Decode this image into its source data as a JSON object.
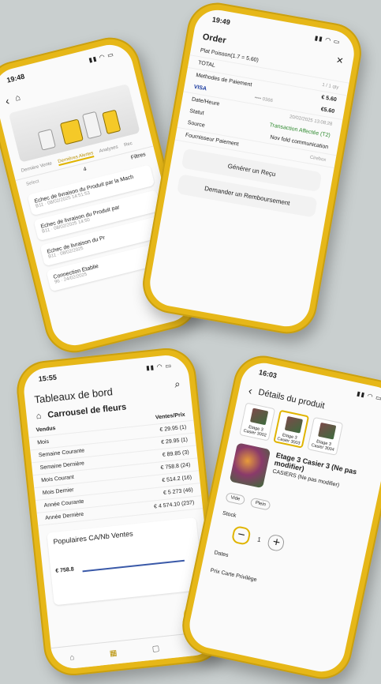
{
  "phone1": {
    "time": "19:48",
    "tabs": [
      "Dernière Vente",
      "Dernières Alertes",
      "Analyses",
      "Rec"
    ],
    "filters": {
      "select": "Select",
      "count": "4",
      "label": "Filtres"
    },
    "alerts": [
      {
        "title": "Echec de livraison du Produit par la Mach",
        "id": "B11",
        "date": "08/02/2025 14:51:53"
      },
      {
        "title": "Echec de livraison du Produit par",
        "id": "B11",
        "date": "08/02/2025 14:50"
      },
      {
        "title": "Echec de livraison du Pr",
        "id": "B11",
        "date": "08/02/2025"
      },
      {
        "title": "Connection Etablie",
        "id": "96",
        "date": "24/02/2025"
      }
    ]
  },
  "phone2": {
    "time": "19:49",
    "title": "Order",
    "product_line": "Plat Poisson(1.7 = 5.60)",
    "total_label": "TOTAL",
    "total_value": "1 / 1 qty",
    "payment_methods_label": "Methodes de Paiement",
    "payment_amount": "€ 5.60",
    "card_brand": "VISA",
    "card_last4": "•••• 0366",
    "details": [
      {
        "k": "Date/Heure",
        "v": "20/02/2025 13:08:28"
      },
      {
        "k": "Statut",
        "v": "Transaction Affectée (T2)"
      },
      {
        "k": "Source",
        "v": "Nov fold communication"
      }
    ],
    "amount_right": "€5.60",
    "provider_label": "Fournisseur Paiement",
    "provider_value": "Cirebox",
    "receipt_button": "Générer un Reçu",
    "refund_button": "Demander un Remboursement"
  },
  "phone3": {
    "time": "15:55",
    "title": "Tableaux de bord",
    "subtitle": "Carrousel de fleurs",
    "col1": "Vendus",
    "col2": "Ventes/Prix",
    "rows": [
      {
        "k": "Mois",
        "v": "€ 29.95 (1)"
      },
      {
        "k": "Semaine Courante",
        "v": "€ 29.95 (1)"
      },
      {
        "k": "Semaine Dernière",
        "v": "€ 89.85 (3)"
      },
      {
        "k": "Mois Courant",
        "v": "€ 758.8 (24)"
      },
      {
        "k": "Mois Dernier",
        "v": "€ 514.2 (16)"
      },
      {
        "k": "Année Courante",
        "v": "€ 5 273 (46)"
      },
      {
        "k": "Année Dernière",
        "v": "€ 4 574.10 (237)"
      }
    ],
    "popular_title": "Populaires CA/Nb Ventes",
    "chart_value": "€ 758.8"
  },
  "phone4": {
    "time": "16:03",
    "title": "Détails du produit",
    "cells": [
      "Etage 3 Casier 3002",
      "Etage 3 Casier 3003",
      "Etage 3 Casier 3004"
    ],
    "product_name": "Etage 3 Casier 3 (Ne pas modifier)",
    "product_sub": "CASIERS (Ne pas modifier)",
    "stock_label": "Stock",
    "chip_empty": "Vide",
    "chip_full": "Plein",
    "stock_value": "1",
    "dates_label": "Dates",
    "price_label": "Prix Carte Privilège"
  }
}
